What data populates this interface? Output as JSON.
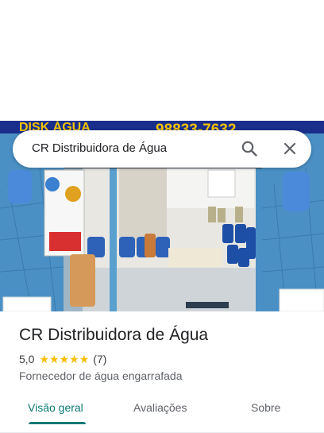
{
  "search": {
    "query": "CR Distribuidora de Água"
  },
  "hero": {
    "banner_text": "DISK ÁGUA",
    "banner_phone": "98833-7632"
  },
  "place": {
    "name": "CR Distribuidora de Água",
    "rating_value": "5,0",
    "stars_filled": 5,
    "review_count": "(7)",
    "category": "Fornecedor de água engarrafada"
  },
  "tabs": [
    {
      "label": "Visão geral",
      "active": true
    },
    {
      "label": "Avaliações",
      "active": false
    },
    {
      "label": "Sobre",
      "active": false
    }
  ],
  "colors": {
    "accent": "#0b7a75",
    "star": "#fbbc04",
    "banner": "#1a2f8c",
    "banner_text": "#f2c400"
  },
  "icons": [
    "search-icon",
    "close-icon",
    "star-icon"
  ]
}
